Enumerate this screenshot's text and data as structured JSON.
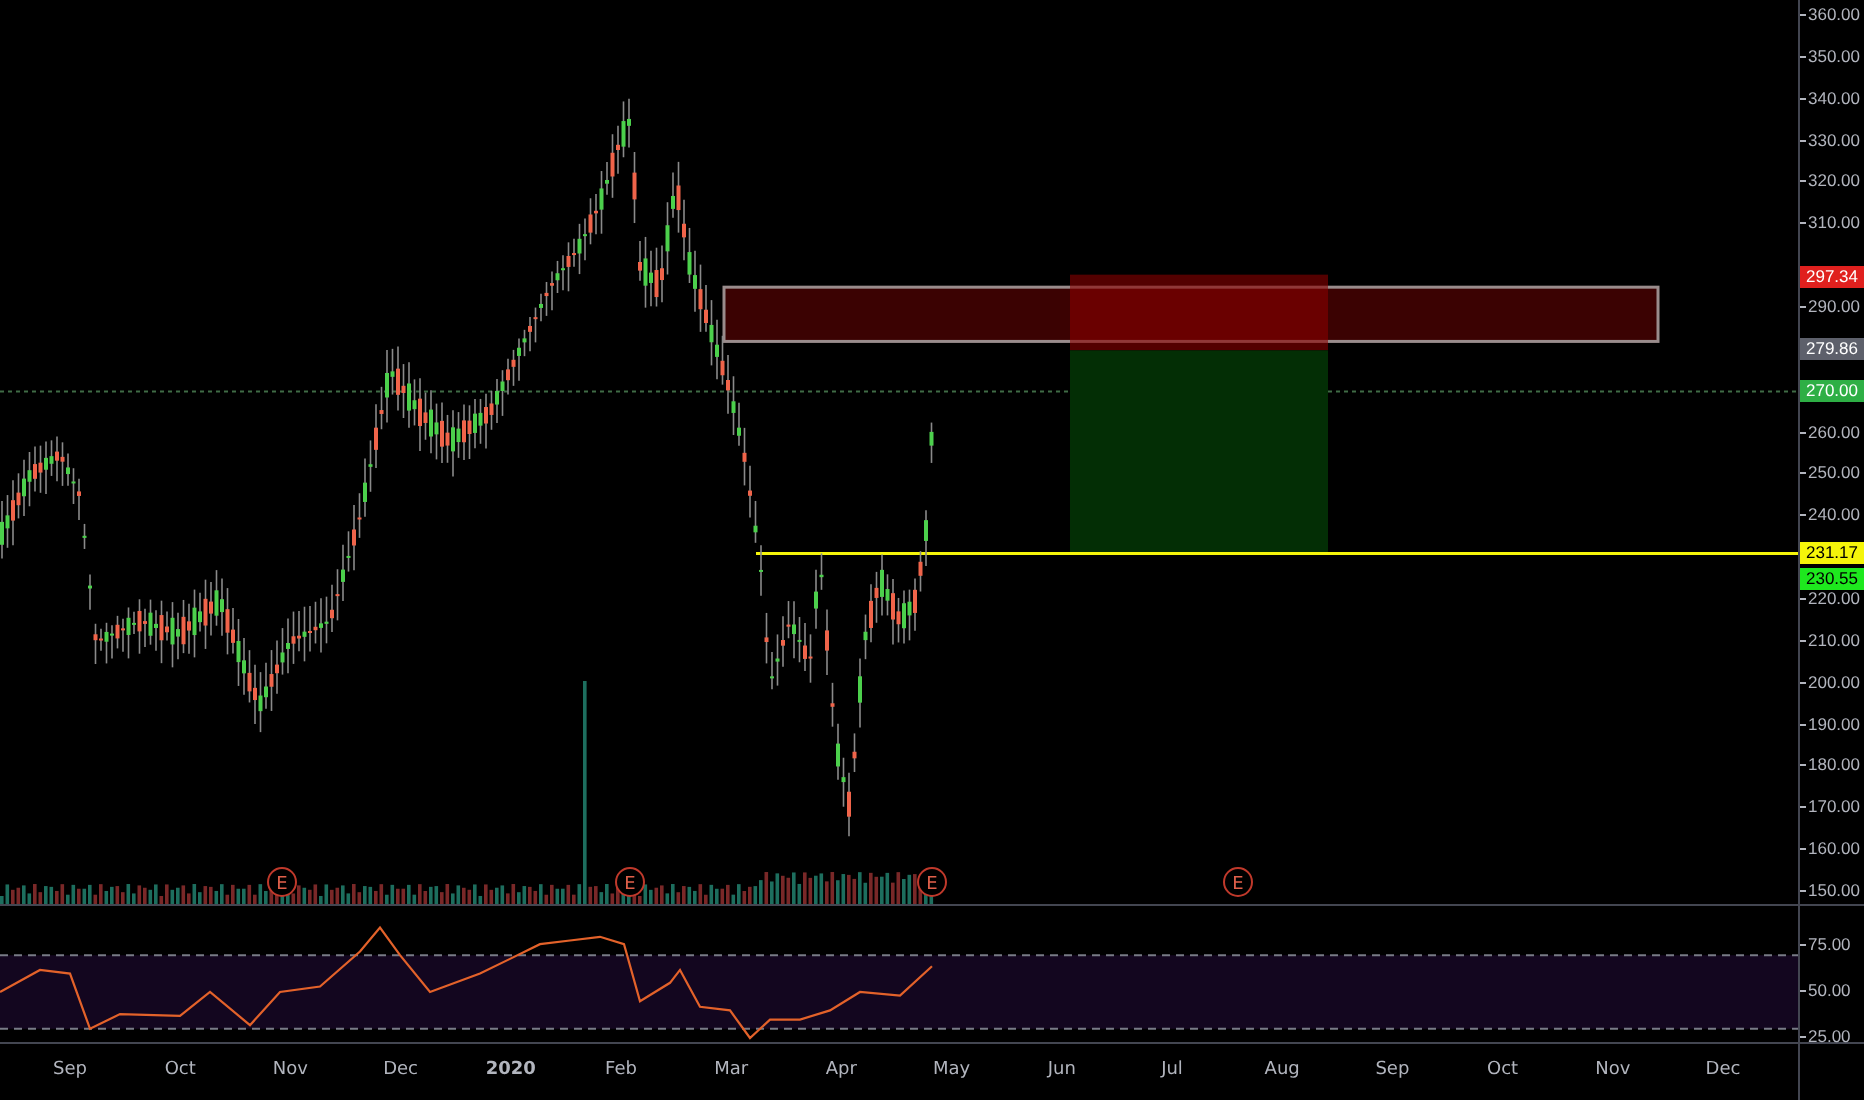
{
  "price_axis": {
    "ticks": [
      "360.00",
      "350.00",
      "340.00",
      "330.00",
      "320.00",
      "310.00",
      "290.00",
      "260.00",
      "250.00",
      "240.00",
      "220.00",
      "210.00",
      "200.00",
      "190.00",
      "180.00",
      "170.00",
      "160.00",
      "150.00"
    ]
  },
  "price_labels": [
    {
      "value": "297.34",
      "color": "#e0201e"
    },
    {
      "value": "279.86",
      "color": "#5d606b"
    },
    {
      "value": "270.00",
      "color": "#2eaf45"
    },
    {
      "value": "231.17",
      "color": "#f5f50a"
    },
    {
      "value": "230.55",
      "color": "#1ee81e"
    }
  ],
  "earnings_markers": [
    "E",
    "E",
    "E",
    "E"
  ],
  "rsi": {
    "ticks": [
      "75.00",
      "50.00",
      "25.00"
    ]
  },
  "time_axis": {
    "labels": [
      {
        "text": "Sep",
        "kind": "month"
      },
      {
        "text": "Oct",
        "kind": "month"
      },
      {
        "text": "Nov",
        "kind": "month"
      },
      {
        "text": "Dec",
        "kind": "month"
      },
      {
        "text": "2020",
        "kind": "year"
      },
      {
        "text": "Feb",
        "kind": "month"
      },
      {
        "text": "Mar",
        "kind": "month"
      },
      {
        "text": "Apr",
        "kind": "month"
      },
      {
        "text": "May",
        "kind": "month"
      },
      {
        "text": "Jun",
        "kind": "month"
      },
      {
        "text": "Jul",
        "kind": "month"
      },
      {
        "text": "Aug",
        "kind": "month"
      },
      {
        "text": "Sep",
        "kind": "month"
      },
      {
        "text": "Oct",
        "kind": "month"
      },
      {
        "text": "Nov",
        "kind": "month"
      },
      {
        "text": "Dec",
        "kind": "month"
      }
    ]
  }
}
